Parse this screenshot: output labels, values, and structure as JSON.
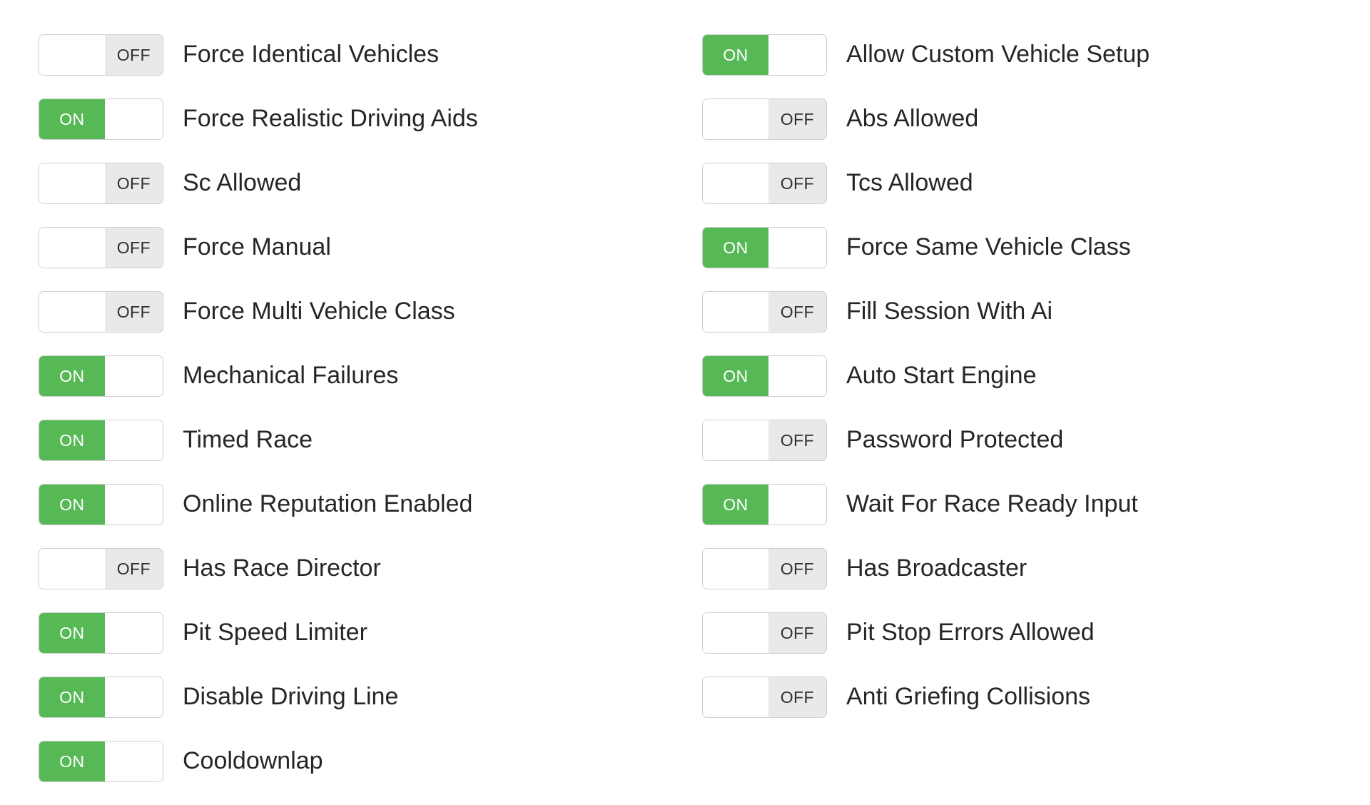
{
  "colors": {
    "on_track": "#57b956",
    "off_track": "#e9e9e9",
    "border": "#cfcfcf",
    "label_text": "#262626",
    "on_text": "#ffffff",
    "off_text": "#2f2f2f",
    "background": "#ffffff"
  },
  "state_labels": {
    "on": "ON",
    "off": "OFF"
  },
  "columns": {
    "left": [
      {
        "label": "Force Identical Vehicles",
        "state": "OFF"
      },
      {
        "label": "Force Realistic Driving Aids",
        "state": "ON"
      },
      {
        "label": "Sc Allowed",
        "state": "OFF"
      },
      {
        "label": "Force Manual",
        "state": "OFF"
      },
      {
        "label": "Force Multi Vehicle Class",
        "state": "OFF"
      },
      {
        "label": "Mechanical Failures",
        "state": "ON"
      },
      {
        "label": "Timed Race",
        "state": "ON"
      },
      {
        "label": "Online Reputation Enabled",
        "state": "ON"
      },
      {
        "label": "Has Race Director",
        "state": "OFF"
      },
      {
        "label": "Pit Speed Limiter",
        "state": "ON"
      },
      {
        "label": "Disable Driving Line",
        "state": "ON"
      },
      {
        "label": "Cooldownlap",
        "state": "ON"
      }
    ],
    "right": [
      {
        "label": "Allow Custom Vehicle Setup",
        "state": "ON"
      },
      {
        "label": "Abs Allowed",
        "state": "OFF"
      },
      {
        "label": "Tcs Allowed",
        "state": "OFF"
      },
      {
        "label": "Force Same Vehicle Class",
        "state": "ON"
      },
      {
        "label": "Fill Session With Ai",
        "state": "OFF"
      },
      {
        "label": "Auto Start Engine",
        "state": "ON"
      },
      {
        "label": "Password Protected",
        "state": "OFF"
      },
      {
        "label": "Wait For Race Ready Input",
        "state": "ON"
      },
      {
        "label": "Has Broadcaster",
        "state": "OFF"
      },
      {
        "label": "Pit Stop Errors Allowed",
        "state": "OFF"
      },
      {
        "label": "Anti Griefing Collisions",
        "state": "OFF"
      }
    ]
  }
}
